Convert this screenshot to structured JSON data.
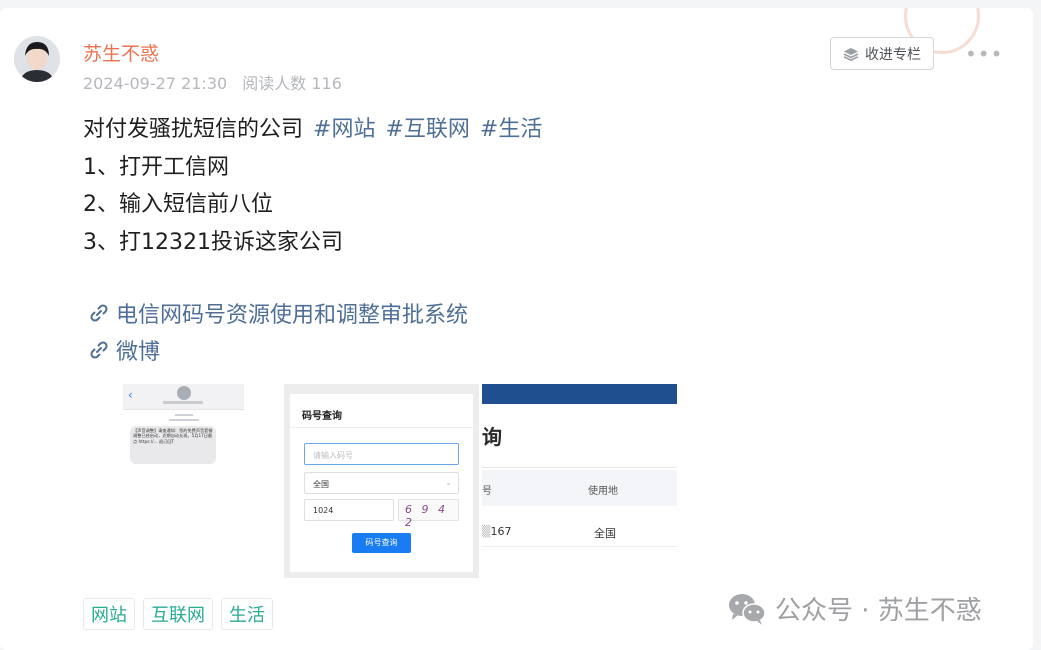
{
  "author": {
    "name": "苏生不惑",
    "date": "2024-09-27 21:30",
    "read_label": "阅读人数 116"
  },
  "actions": {
    "collect_label": "收进专栏",
    "more_label": "•••"
  },
  "post": {
    "title_text": "对付发骚扰短信的公司",
    "inline_tags": [
      "#网站",
      "#互联网",
      "#生活"
    ],
    "lines": [
      "1、打开工信网",
      "2、输入短信前八位",
      "3、打12321投诉这家公司"
    ]
  },
  "links": [
    {
      "label": "电信网码号资源使用和调整审批系统",
      "icon": "link-icon"
    },
    {
      "label": "微博",
      "icon": "link-icon"
    }
  ],
  "images": {
    "sms_preview": {
      "text": "【声音调整】请查通知：您的免费声音套餐调整已经启动，近期自动允现，5月17日截点 https://... 退订回T"
    },
    "query_form": {
      "title": "码号查询",
      "input_placeholder": "请输入码号",
      "select_value": "全国",
      "captcha_input": "1024",
      "captcha_image": "6 9 4 2",
      "button_label": "码号查询"
    },
    "result_table": {
      "heading": "询",
      "col_number": "号",
      "col_usage": "使用地",
      "row_number": "167",
      "row_usage": "全国"
    }
  },
  "tags": [
    "网站",
    "互联网",
    "生活"
  ],
  "watermark": {
    "label": "公众号 · 苏生不惑"
  },
  "colors": {
    "author_name": "#eb7350",
    "link": "#4f6f97",
    "tag": "#2aab93",
    "query_button": "#1a7cf2"
  }
}
